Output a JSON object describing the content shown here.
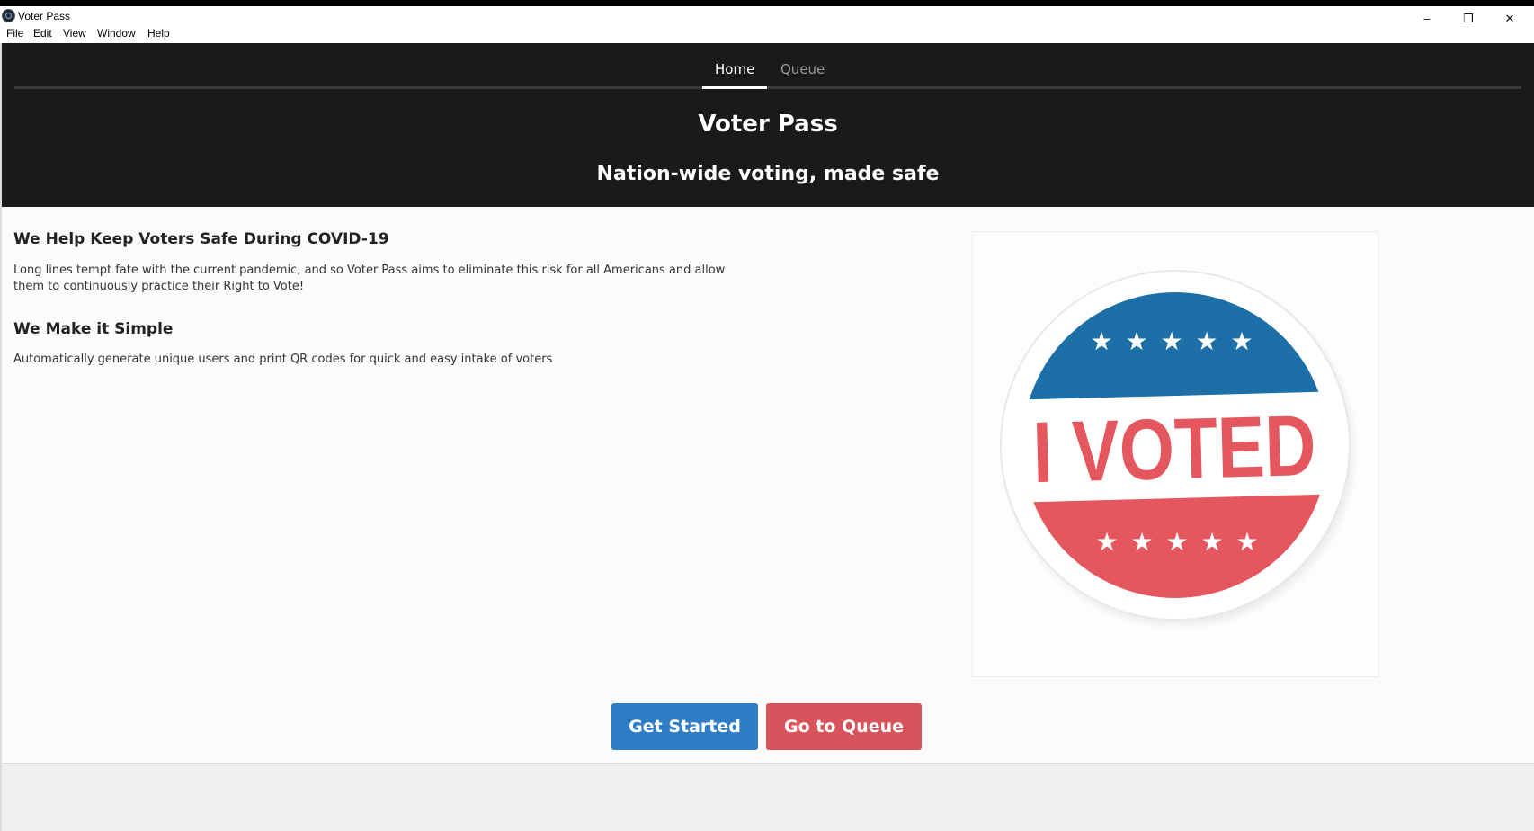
{
  "window": {
    "title": "Voter Pass",
    "controls": {
      "minimize": "–",
      "restore": "❐",
      "close": "✕"
    }
  },
  "menu": [
    "File",
    "Edit",
    "View",
    "Window",
    "Help"
  ],
  "tabs": [
    {
      "label": "Home",
      "active": true
    },
    {
      "label": "Queue",
      "active": false
    }
  ],
  "header": {
    "title": "Voter Pass",
    "subtitle": "Nation-wide voting, made safe"
  },
  "sections": [
    {
      "heading": "We Help Keep Voters Safe During COVID-19",
      "body": "Long lines tempt fate with the current pandemic, and so Voter Pass aims to eliminate this risk for all Americans and allow them to continuously practice their Right to Vote!"
    },
    {
      "heading": "We Make it Simple",
      "body": "Automatically generate unique users and print QR codes for quick and easy intake of voters"
    }
  ],
  "badge": {
    "text": "I VOTED",
    "colors": {
      "blue": "#1d6fa8",
      "red": "#e5575f",
      "white": "#ffffff"
    }
  },
  "buttons": {
    "get_started": {
      "label": "Get Started",
      "color": "#2f7dc4"
    },
    "go_to_queue": {
      "label": "Go to Queue",
      "color": "#d9535c"
    }
  }
}
